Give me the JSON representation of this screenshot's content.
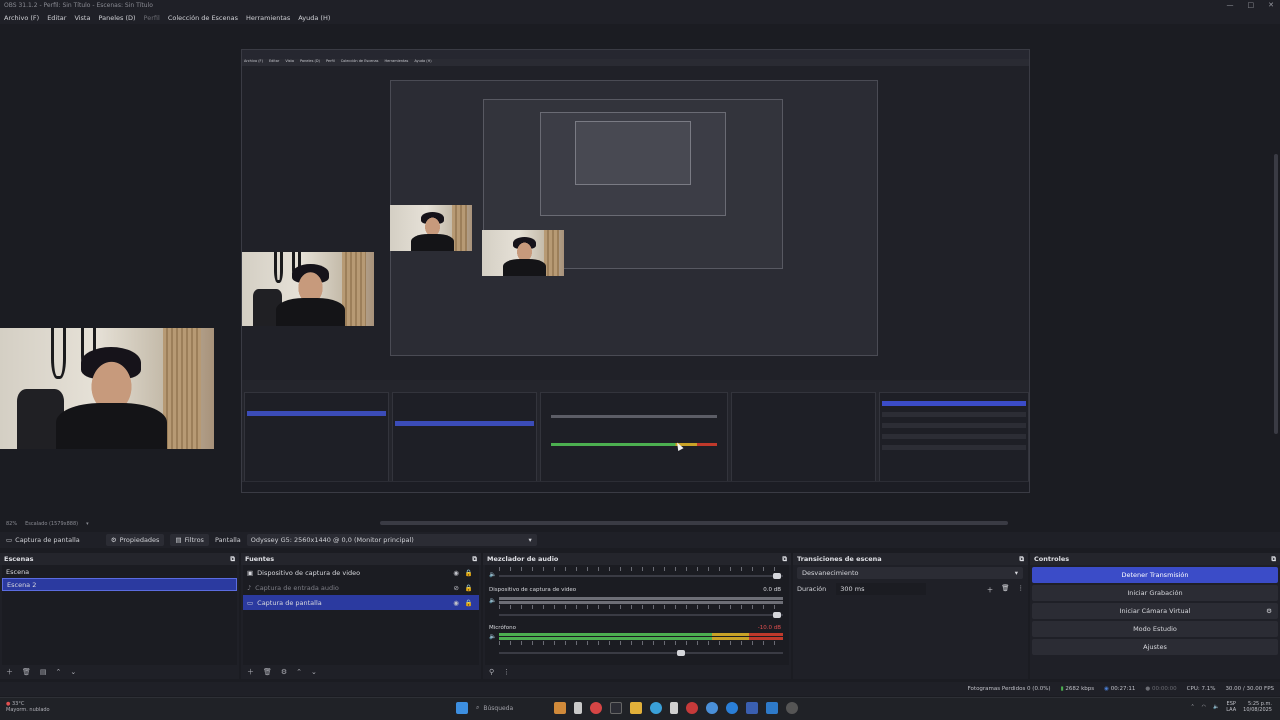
{
  "window": {
    "title": "OBS 31.1.2 - Perfil: Sin Título - Escenas: Sin Título",
    "controls": {
      "minimize": "—",
      "maximize": "□",
      "close": "✕"
    }
  },
  "menu": [
    "Archivo (F)",
    "Editar",
    "Vista",
    "Paneles (D)",
    "Perfil",
    "Colección de Escenas",
    "Herramientas",
    "Ayuda (H)"
  ],
  "nested_menu": [
    "Archivo (F)",
    "Editar",
    "Vista",
    "Paneles (D)",
    "Perfil",
    "Colección de Escenas",
    "Herramientas",
    "Ayuda (H)"
  ],
  "zoom": {
    "value": "82%",
    "resolution": "Escalado (1579x888)"
  },
  "source_toolbar": {
    "current_source": "Captura de pantalla",
    "properties": "Propiedades",
    "filters": "Filtros",
    "label": "Pantalla",
    "display": "Odyssey G5: 2560x1440 @ 0,0 (Monitor principal)"
  },
  "scenes": {
    "title": "Escenas",
    "items": [
      "Escena",
      "Escena 2"
    ]
  },
  "sources": {
    "title": "Fuentes",
    "items": [
      {
        "name": "Dispositivo de captura de video"
      },
      {
        "name": "Captura de entrada audio"
      },
      {
        "name": "Captura de pantalla"
      }
    ]
  },
  "mixer": {
    "title": "Mezclador de audio",
    "channels": [
      {
        "name": "",
        "db": ""
      },
      {
        "name": "Dispositivo de captura de video",
        "db": "0.0 dB"
      },
      {
        "name": "Micrófono",
        "db": "-10.0 dB"
      }
    ],
    "scale": [
      "-60",
      "-55",
      "-50",
      "-45",
      "-40",
      "-35",
      "-30",
      "-25",
      "-20",
      "-15",
      "-10",
      "-5",
      "0"
    ]
  },
  "transitions": {
    "title": "Transiciones de escena",
    "selected": "Desvanecimiento",
    "duration_label": "Duración",
    "duration_value": "300 ms"
  },
  "controls": {
    "title": "Controles",
    "stop_stream": "Detener Transmisión",
    "start_recording": "Iniciar Grabación",
    "start_virtual_cam": "Iniciar Cámara Virtual",
    "studio_mode": "Modo Estudio",
    "settings": "Ajustes"
  },
  "status": {
    "dropped": "Fotogramas Perdidos 0 (0.0%)",
    "bitrate": "2682 kbps",
    "stream_time": "00:27:11",
    "rec_time": "00:00:00",
    "cpu": "CPU: 7.1%",
    "fps": "30.00 / 30.00 FPS"
  },
  "taskbar": {
    "weather_temp": "33°C",
    "weather_desc": "Mayorm. nublado",
    "search": "Búsqueda",
    "lang1": "ESP",
    "lang2": "LAA",
    "time": "5:25 p.m.",
    "date": "10/08/2025"
  },
  "colors": {
    "accent": "#3b4cc8",
    "selection": "#2b3aa0",
    "background": "#1b1c22",
    "panel": "#1f2027"
  }
}
